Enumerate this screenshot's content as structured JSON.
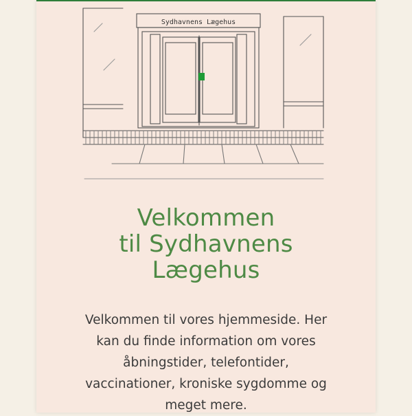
{
  "colors": {
    "accent": "#4e8a45",
    "rule": "#2e7d3a",
    "page_bg": "#f8e8df",
    "outer_bg": "#f5f0e6",
    "body_text": "#3b3b3b",
    "door_marker": "#1f9b36"
  },
  "hero": {
    "sign_text": "Sydhavnens Lægehus",
    "image": "storefront-sketch-illustration"
  },
  "heading": {
    "lines": [
      "Velkommen",
      "til Sydhavnens",
      "Lægehus"
    ]
  },
  "intro": {
    "text": "Velkommen til vores hjemmeside. Her kan du finde information om vores åbningstider, telefontider, vaccinationer, kroniske sygdomme og meget mere."
  }
}
